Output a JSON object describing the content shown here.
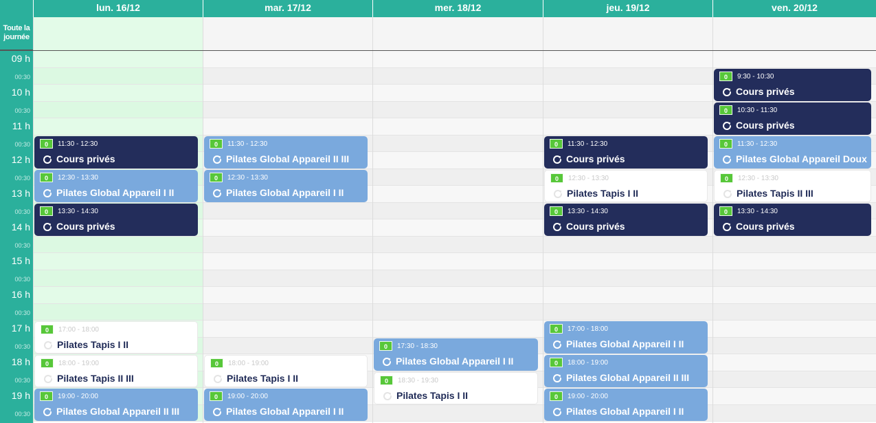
{
  "calendar": {
    "allday_label": "Toute la journée",
    "days": [
      {
        "label": "lun. 16/12",
        "today": true
      },
      {
        "label": "mar. 17/12",
        "today": false
      },
      {
        "label": "mer. 18/12",
        "today": false
      },
      {
        "label": "jeu. 19/12",
        "today": false
      },
      {
        "label": "ven. 20/12",
        "today": false
      }
    ],
    "time_slots": [
      "09 h",
      "00:30",
      "10 h",
      "00:30",
      "11 h",
      "00:30",
      "12 h",
      "00:30",
      "13 h",
      "00:30",
      "14 h",
      "00:30",
      "15 h",
      "00:30",
      "16 h",
      "00:30",
      "17 h",
      "00:30",
      "18 h",
      "00:30",
      "19 h",
      "00:30"
    ],
    "events": [
      {
        "day": 0,
        "start": 11.5,
        "end": 12.5,
        "time": "11:30 - 12:30",
        "title": "Cours privés",
        "style": "dark",
        "badge": "0",
        "icon": "repeat-icon"
      },
      {
        "day": 0,
        "start": 12.5,
        "end": 13.5,
        "time": "12:30 - 13:30",
        "title": "Pilates Global Appareil I II",
        "style": "blue",
        "badge": "0",
        "icon": "repeat-icon"
      },
      {
        "day": 0,
        "start": 13.5,
        "end": 14.5,
        "time": "13:30 - 14:30",
        "title": "Cours privés",
        "style": "dark",
        "badge": "0",
        "icon": "repeat-icon"
      },
      {
        "day": 0,
        "start": 17,
        "end": 18,
        "time": "17:00 - 18:00",
        "title": "Pilates Tapis I II",
        "style": "white",
        "badge": "0",
        "icon": "repeat-icon"
      },
      {
        "day": 0,
        "start": 18,
        "end": 19,
        "time": "18:00 - 19:00",
        "title": "Pilates Tapis II III",
        "style": "white",
        "badge": "0",
        "icon": "repeat-icon"
      },
      {
        "day": 0,
        "start": 19,
        "end": 20,
        "time": "19:00 - 20:00",
        "title": "Pilates Global Appareil II III",
        "style": "blue",
        "badge": "0",
        "icon": "repeat-icon"
      },
      {
        "day": 1,
        "start": 11.5,
        "end": 12.5,
        "time": "11:30 - 12:30",
        "title": "Pilates Global Appareil II III",
        "style": "blue",
        "badge": "0",
        "icon": "repeat-icon"
      },
      {
        "day": 1,
        "start": 12.5,
        "end": 13.5,
        "time": "12:30 - 13:30",
        "title": "Pilates Global Appareil I II",
        "style": "blue",
        "badge": "0",
        "icon": "repeat-icon"
      },
      {
        "day": 1,
        "start": 18,
        "end": 19,
        "time": "18:00 - 19:00",
        "title": "Pilates Tapis I II",
        "style": "white",
        "badge": "0",
        "icon": "repeat-icon"
      },
      {
        "day": 1,
        "start": 19,
        "end": 20,
        "time": "19:00 - 20:00",
        "title": "Pilates Global Appareil I II",
        "style": "blue",
        "badge": "0",
        "icon": "repeat-icon"
      },
      {
        "day": 2,
        "start": 17.5,
        "end": 18.5,
        "time": "17:30 - 18:30",
        "title": "Pilates Global Appareil I II",
        "style": "blue",
        "badge": "0",
        "icon": "repeat-icon"
      },
      {
        "day": 2,
        "start": 18.5,
        "end": 19.5,
        "time": "18:30 - 19:30",
        "title": "Pilates Tapis I II",
        "style": "white",
        "badge": "0",
        "icon": "repeat-icon"
      },
      {
        "day": 3,
        "start": 11.5,
        "end": 12.5,
        "time": "11:30 - 12:30",
        "title": "Cours privés",
        "style": "dark",
        "badge": "0",
        "icon": "repeat-icon"
      },
      {
        "day": 3,
        "start": 12.5,
        "end": 13.5,
        "time": "12:30 - 13:30",
        "title": "Pilates Tapis I II",
        "style": "white",
        "badge": "0",
        "icon": "repeat-icon"
      },
      {
        "day": 3,
        "start": 13.5,
        "end": 14.5,
        "time": "13:30 - 14:30",
        "title": "Cours privés",
        "style": "dark",
        "badge": "0",
        "icon": "repeat-icon"
      },
      {
        "day": 3,
        "start": 17,
        "end": 18,
        "time": "17:00 - 18:00",
        "title": "Pilates Global Appareil I II",
        "style": "blue",
        "badge": "0",
        "icon": "repeat-icon"
      },
      {
        "day": 3,
        "start": 18,
        "end": 19,
        "time": "18:00 - 19:00",
        "title": "Pilates Global Appareil II III",
        "style": "blue",
        "badge": "0",
        "icon": "repeat-icon"
      },
      {
        "day": 3,
        "start": 19,
        "end": 20,
        "time": "19:00 - 20:00",
        "title": "Pilates Global Appareil I II",
        "style": "blue",
        "badge": "0",
        "icon": "repeat-icon"
      },
      {
        "day": 4,
        "start": 9.5,
        "end": 10.5,
        "time": "9:30 - 10:30",
        "title": "Cours privés",
        "style": "dark",
        "badge": "0",
        "icon": "repeat-icon"
      },
      {
        "day": 4,
        "start": 10.5,
        "end": 11.5,
        "time": "10:30 - 11:30",
        "title": "Cours privés",
        "style": "dark",
        "badge": "0",
        "icon": "repeat-icon"
      },
      {
        "day": 4,
        "start": 11.5,
        "end": 12.5,
        "time": "11:30 - 12:30",
        "title": "Pilates Global Appareil Doux",
        "style": "blue",
        "badge": "0",
        "icon": "repeat-icon"
      },
      {
        "day": 4,
        "start": 12.5,
        "end": 13.5,
        "time": "12:30 - 13:30",
        "title": "Pilates Tapis II III",
        "style": "white",
        "badge": "0",
        "icon": "repeat-icon"
      },
      {
        "day": 4,
        "start": 13.5,
        "end": 14.5,
        "time": "13:30 - 14:30",
        "title": "Cours privés",
        "style": "dark",
        "badge": "0",
        "icon": "repeat-icon"
      }
    ],
    "colors": {
      "header": "#2bb09c",
      "today_bg": "#e3fbe8",
      "event_dark": "#232d5b",
      "event_blue": "#7aa9dd",
      "event_white": "#ffffff",
      "badge_green": "#57c739"
    }
  }
}
